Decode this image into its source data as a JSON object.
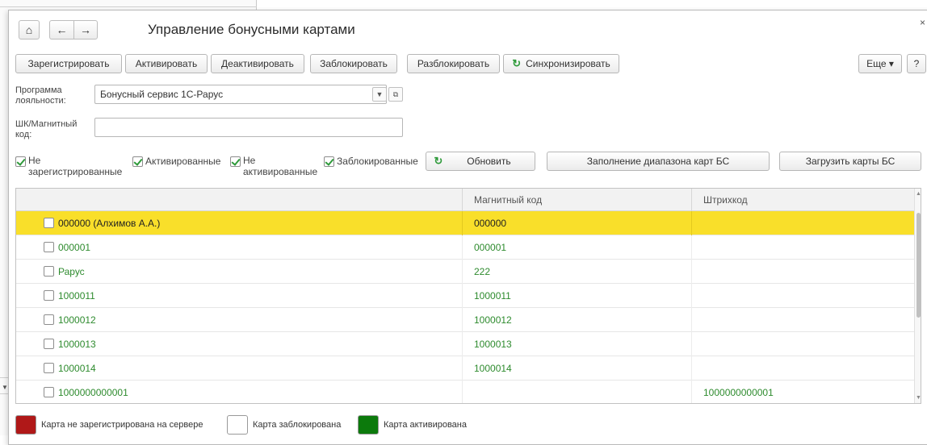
{
  "window": {
    "title": "Управление бонусными картами",
    "close_glyph": "×"
  },
  "nav": {
    "home_icon": "home-icon",
    "back_icon": "arrow-left-icon",
    "forward_icon": "arrow-right-icon"
  },
  "toolbar": {
    "register": "Зарегистрировать",
    "activate": "Активировать",
    "deactivate": "Деактивировать",
    "block": "Заблокировать",
    "unblock": "Разблокировать",
    "sync": "Синхронизировать",
    "more": "Еще ▾",
    "help": "?"
  },
  "filters": {
    "program_label_1": "Программа",
    "program_label_2": "лояльности:",
    "program_value": "Бонусный сервис 1С-Рарус",
    "code_label_1": "ШК/Магнитный",
    "code_label_2": "код:",
    "code_value": ""
  },
  "checkboxes": [
    {
      "line1": "Не",
      "line2": "зарегистрированные",
      "checked": true
    },
    {
      "line1": "Активированные",
      "line2": "",
      "checked": true
    },
    {
      "line1": "Не",
      "line2": "активированные",
      "checked": true
    },
    {
      "line1": "Заблокированные",
      "line2": "",
      "checked": true
    }
  ],
  "actions": {
    "refresh": "Обновить",
    "fill_range": "Заполнение диапазона карт БС",
    "load_cards": "Загрузить карты БС"
  },
  "table": {
    "columns": [
      "",
      "Магнитный код",
      "Штрихкод"
    ],
    "rows": [
      {
        "name": "000000 (Алхимов А.А.)",
        "magnetic": "000000",
        "barcode": "",
        "selected": true
      },
      {
        "name": "000001",
        "magnetic": "000001",
        "barcode": ""
      },
      {
        "name": "Рарус",
        "magnetic": "222",
        "barcode": ""
      },
      {
        "name": "1000011",
        "magnetic": "1000011",
        "barcode": ""
      },
      {
        "name": "1000012",
        "magnetic": "1000012",
        "barcode": ""
      },
      {
        "name": "1000013",
        "magnetic": "1000013",
        "barcode": ""
      },
      {
        "name": "1000014",
        "magnetic": "1000014",
        "barcode": ""
      },
      {
        "name": "1000000000001",
        "magnetic": "",
        "barcode": "1000000000001"
      }
    ]
  },
  "legend": {
    "not_registered": "Карта не зарегистрирована на сервере",
    "blocked": "Карта заблокирована",
    "activated": "Карта активирована",
    "colors": {
      "not_registered": "#b01818",
      "blocked": "#ffffff",
      "activated": "#0c7a0c"
    }
  }
}
